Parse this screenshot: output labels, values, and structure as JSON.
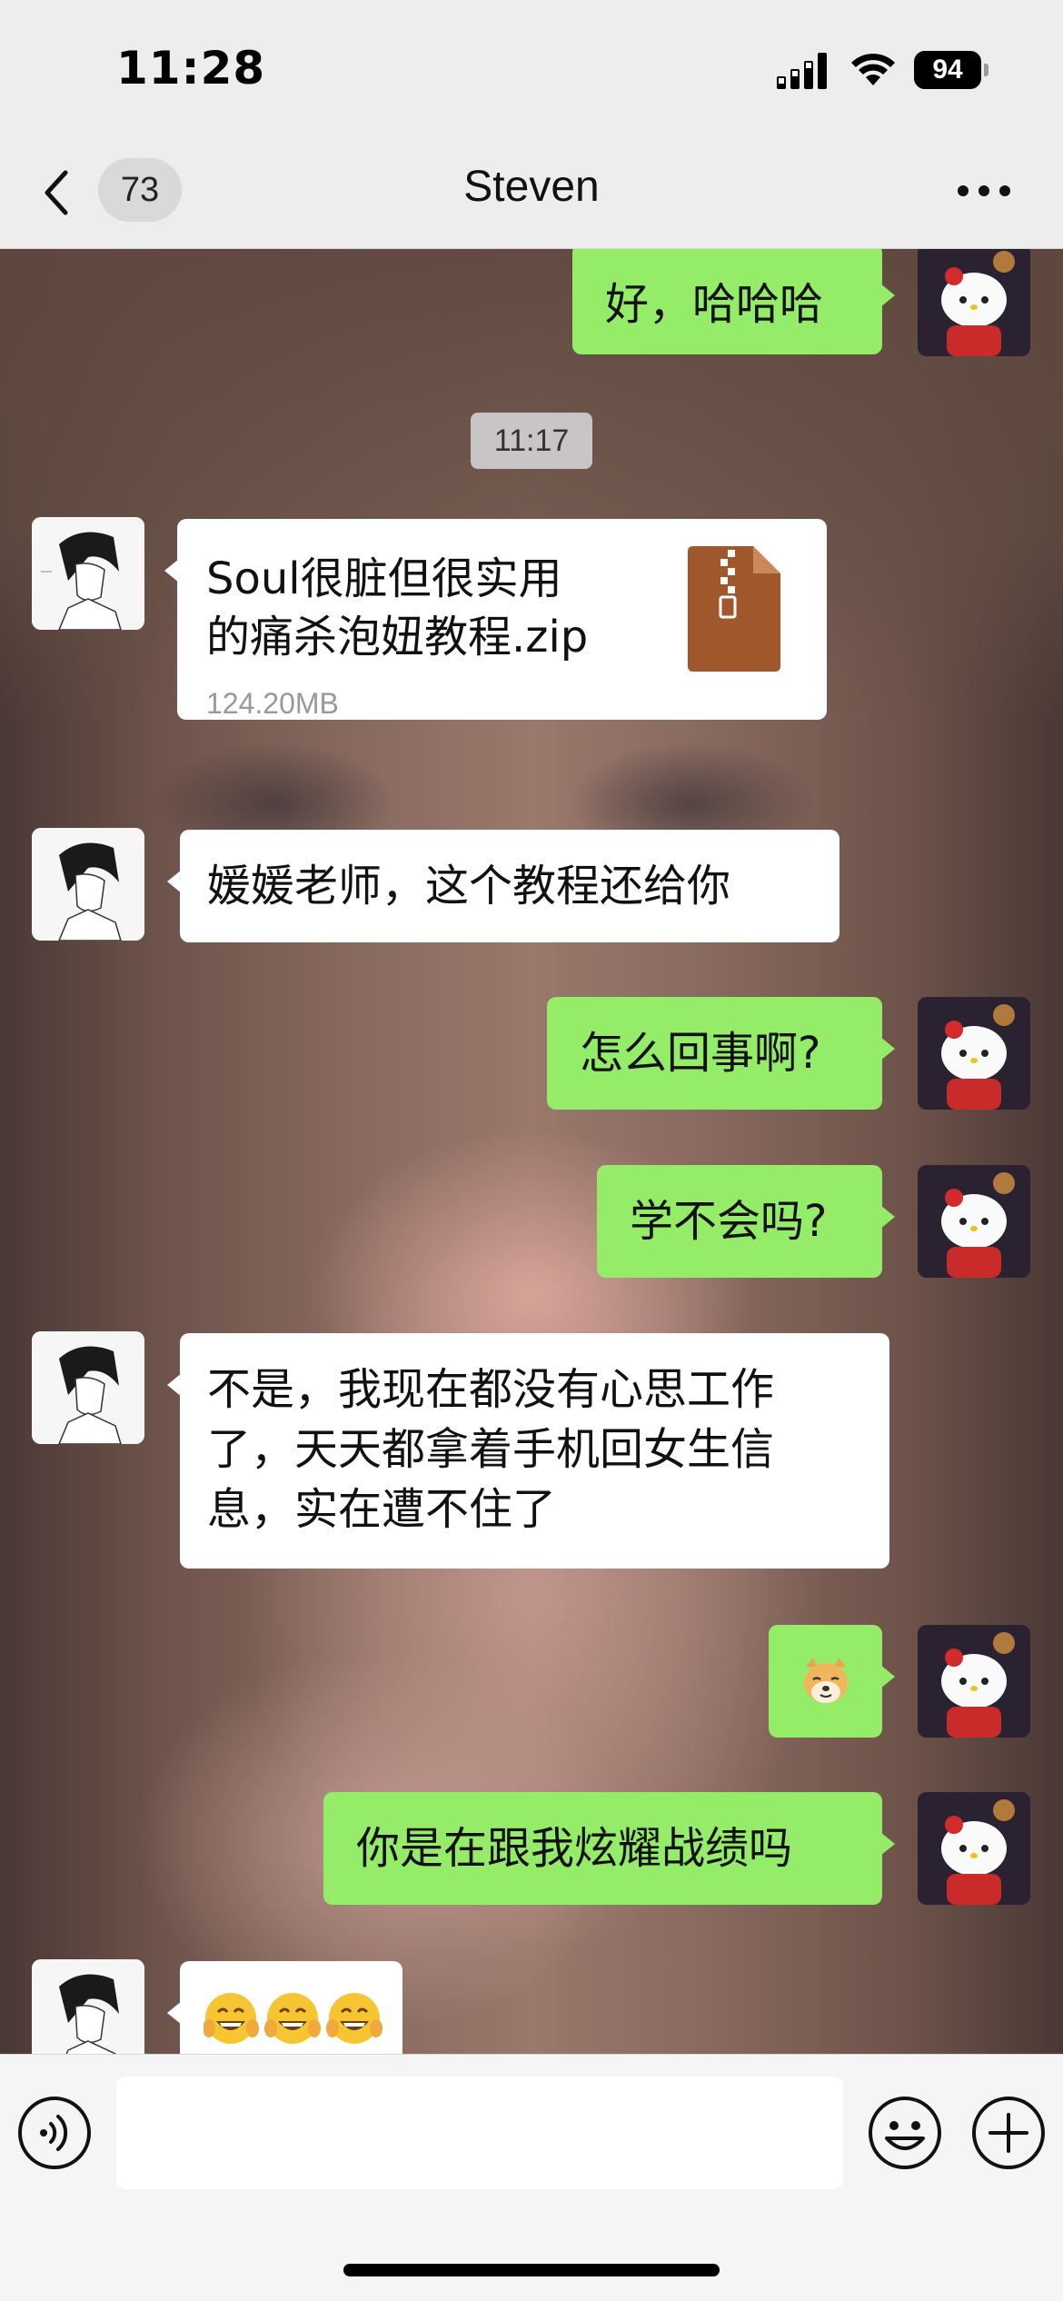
{
  "status_bar": {
    "time": "11:28",
    "battery": "94"
  },
  "header": {
    "unread_count": "73",
    "title": "Steven"
  },
  "messages": [
    {
      "side": "right",
      "type": "text",
      "text": "好，哈哈哈"
    },
    {
      "type": "timestamp",
      "text": "11:17"
    },
    {
      "side": "left",
      "type": "file",
      "file_name_line1": "Soul很脏但很实用",
      "file_name_line2": "的痛杀泡妞教程.zip",
      "file_size": "124.20MB"
    },
    {
      "side": "left",
      "type": "text",
      "text": "媛媛老师，这个教程还给你"
    },
    {
      "side": "right",
      "type": "text",
      "text": "怎么回事啊?"
    },
    {
      "side": "right",
      "type": "text",
      "text": "学不会吗?"
    },
    {
      "side": "left",
      "type": "text",
      "lines": [
        "不是，我现在都没有心思工作",
        "了，天天都拿着手机回女生信",
        "息，实在遭不住了"
      ]
    },
    {
      "side": "right",
      "type": "emoji",
      "emoji": "doge-icon"
    },
    {
      "side": "right",
      "type": "text",
      "text": "你是在跟我炫耀战绩吗"
    },
    {
      "side": "left",
      "type": "emoji",
      "emoji": "grin-face-icon x3"
    }
  ],
  "input": {
    "value": ""
  },
  "colors": {
    "green_bubble": "#95ec69",
    "white_bubble": "#ffffff",
    "background": "#ededed"
  }
}
